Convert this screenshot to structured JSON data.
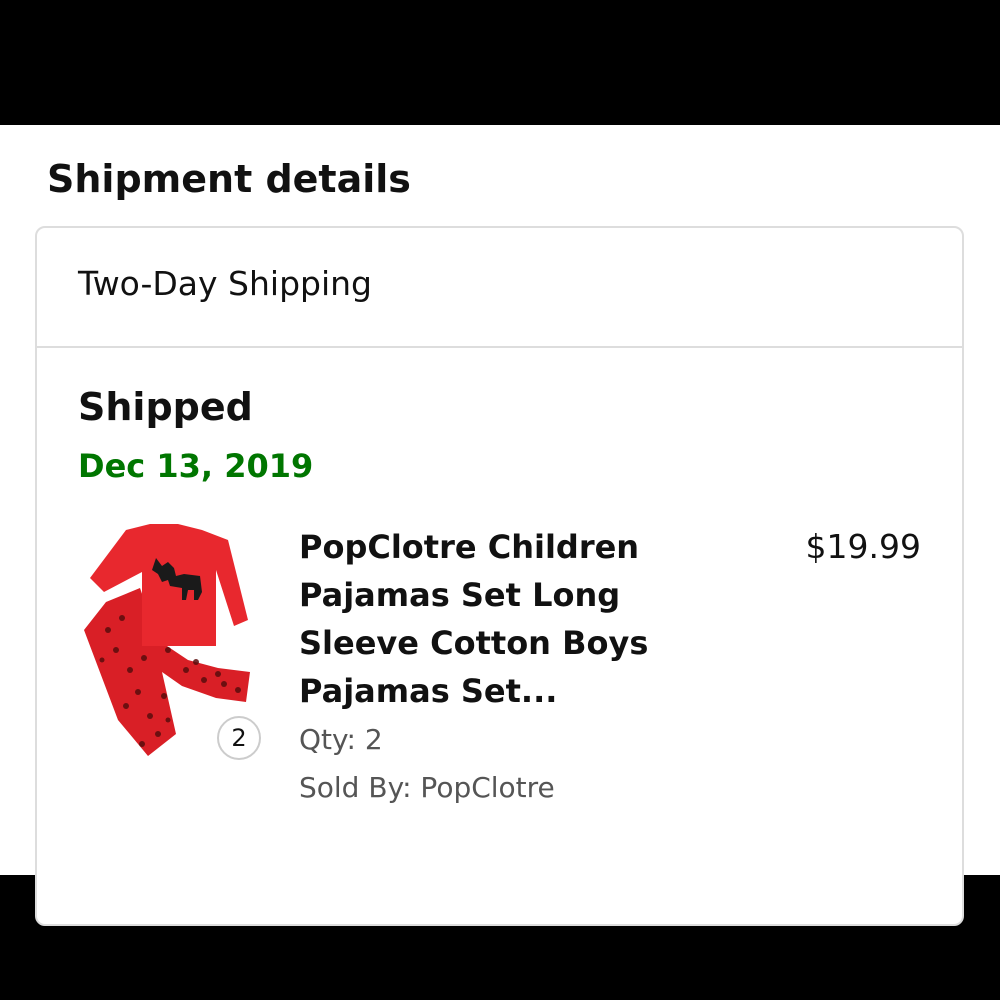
{
  "shipment": {
    "section_title": "Shipment details",
    "shipping_method": "Two-Day Shipping",
    "status": "Shipped",
    "status_date": "Dec 13, 2019",
    "status_date_color": "#007600"
  },
  "item": {
    "title": "PopClotre Children Pajamas Set Long Sleeve Cotton Boys Pajamas Set...",
    "price": "$19.99",
    "qty_badge": "2",
    "qty_label": "Qty: 2",
    "sold_by": "Sold By: PopClotre",
    "image_icon": "red-moose-pajamas-image"
  }
}
